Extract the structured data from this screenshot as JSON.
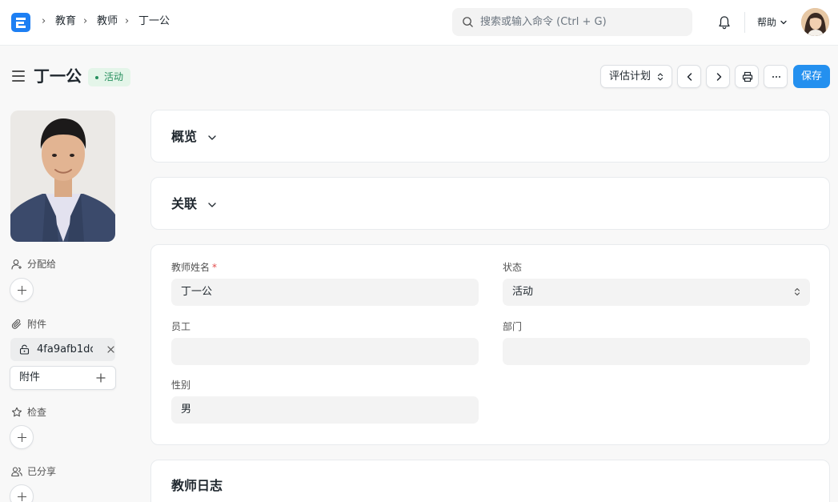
{
  "breadcrumb": [
    "教育",
    "教师",
    "丁一公"
  ],
  "search": {
    "placeholder": "搜索或输入命令 (Ctrl + G)"
  },
  "navbar": {
    "help_label": "帮助"
  },
  "doc": {
    "title": "丁一公",
    "status": "活动",
    "plan_button": "评估计划",
    "save_button": "保存"
  },
  "sidebar": {
    "assign_label": "分配给",
    "attachments_label": "附件",
    "attachment_file": "4fa9afb1dc",
    "attach_button": "附件",
    "review_label": "检查",
    "shared_label": "已分享"
  },
  "sections": {
    "overview": "概览",
    "links": "关联",
    "log": "教师日志"
  },
  "form": {
    "name_label": "教师姓名",
    "name_value": "丁一公",
    "status_label": "状态",
    "status_value": "活动",
    "employee_label": "员工",
    "employee_value": "",
    "department_label": "部门",
    "department_value": "",
    "gender_label": "性别",
    "gender_value": "男"
  },
  "colors": {
    "primary": "#2490ef",
    "status_bg": "#e4f5e9",
    "status_text": "#278f5e",
    "required": "#e24c4c"
  }
}
